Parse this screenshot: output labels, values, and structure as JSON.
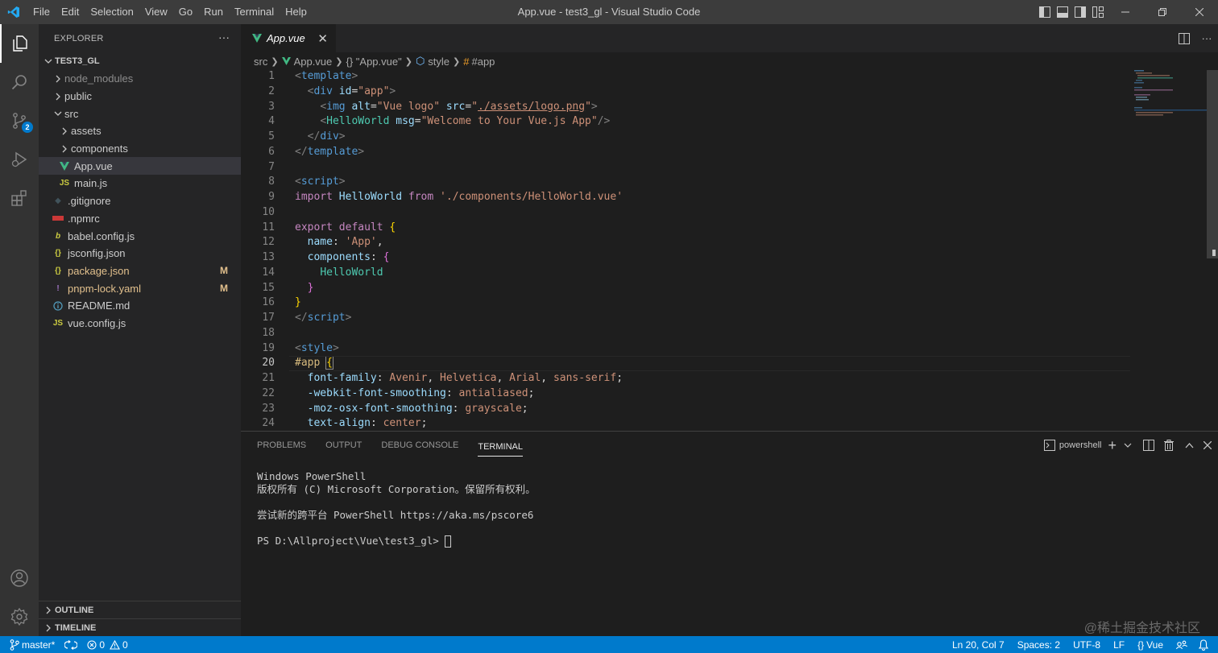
{
  "titlebar": {
    "menu": [
      "File",
      "Edit",
      "Selection",
      "View",
      "Go",
      "Run",
      "Terminal",
      "Help"
    ],
    "title": "App.vue - test3_gl - Visual Studio Code"
  },
  "activity": {
    "scm_badge": "2"
  },
  "explorer": {
    "header": "EXPLORER",
    "root": "TEST3_GL",
    "items": [
      {
        "label": "node_modules",
        "icon": "chevron-right",
        "depth": 1
      },
      {
        "label": "public",
        "icon": "chevron-right",
        "depth": 1
      },
      {
        "label": "src",
        "icon": "chevron-down",
        "depth": 1
      },
      {
        "label": "assets",
        "icon": "chevron-right",
        "depth": 2
      },
      {
        "label": "components",
        "icon": "chevron-right",
        "depth": 2
      },
      {
        "label": "App.vue",
        "icon": "vue-icon",
        "depth": 2
      },
      {
        "label": "main.js",
        "icon": "js-icon",
        "depth": 2
      },
      {
        "label": ".gitignore",
        "icon": "git-icon",
        "depth": 1
      },
      {
        "label": ".npmrc",
        "icon": "npm-icon",
        "depth": 1
      },
      {
        "label": "babel.config.js",
        "icon": "babel-icon",
        "depth": 1
      },
      {
        "label": "jsconfig.json",
        "icon": "json-icon",
        "depth": 1
      },
      {
        "label": "package.json",
        "icon": "json-icon",
        "depth": 1,
        "status": "M"
      },
      {
        "label": "pnpm-lock.yaml",
        "icon": "yaml-icon",
        "depth": 1,
        "status": "M"
      },
      {
        "label": "README.md",
        "icon": "info-icon",
        "depth": 1
      },
      {
        "label": "vue.config.js",
        "icon": "js-icon",
        "depth": 1
      }
    ],
    "outline": "OUTLINE",
    "timeline": "TIMELINE"
  },
  "editor": {
    "tab_label": "App.vue",
    "breadcrumb": [
      "src",
      "App.vue",
      "{} \"App.vue\"",
      "style",
      "#app"
    ],
    "current_line": 20,
    "lines": [
      "1",
      "2",
      "3",
      "4",
      "5",
      "6",
      "7",
      "8",
      "9",
      "10",
      "11",
      "12",
      "13",
      "14",
      "15",
      "16",
      "17",
      "18",
      "19",
      "20",
      "21",
      "22",
      "23",
      "24"
    ]
  },
  "panel": {
    "tabs": [
      "PROBLEMS",
      "OUTPUT",
      "DEBUG CONSOLE",
      "TERMINAL"
    ],
    "active_tab": "TERMINAL",
    "shell": "powershell",
    "terminal_lines": [
      "Windows PowerShell",
      "版权所有 (C) Microsoft Corporation。保留所有权利。",
      "",
      "尝试新的跨平台 PowerShell https://aka.ms/pscore6",
      "",
      "PS D:\\Allproject\\Vue\\test3_gl> "
    ]
  },
  "statusbar": {
    "branch": "master*",
    "errors": "0",
    "warnings": "0",
    "position": "Ln 20, Col 7",
    "spaces": "Spaces: 2",
    "encoding": "UTF-8",
    "eol": "LF",
    "language": "Vue"
  },
  "watermark": "@稀土掘金技术社区",
  "colors": {
    "accent": "#007acc",
    "vue": "#41b883",
    "modified": "#e2c08d"
  }
}
